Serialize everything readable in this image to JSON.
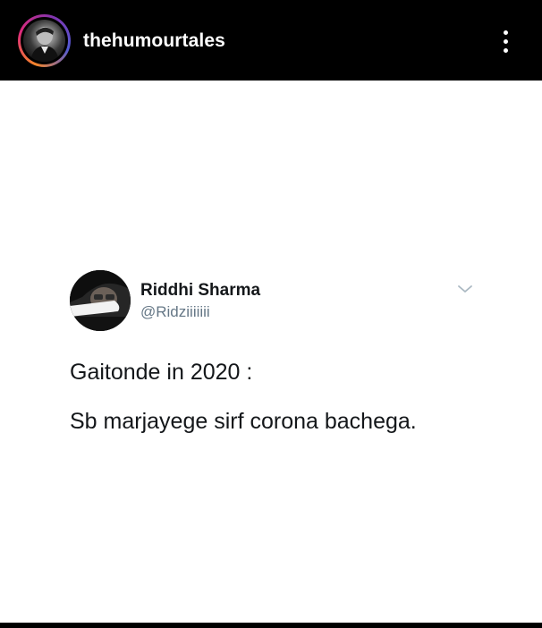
{
  "header": {
    "username": "thehumourtales",
    "avatar_icon": "profile-photo",
    "menu_icon": "more-vertical-icon"
  },
  "tweet": {
    "display_name": "Riddhi Sharma",
    "handle": "@Ridziiiiiii",
    "menu_icon": "chevron-down-icon",
    "lines": [
      "Gaitonde in 2020 :",
      "Sb marjayege sirf corona bachega."
    ]
  },
  "colors": {
    "header_bg": "#000000",
    "post_bg": "#ffffff",
    "text_primary": "#14171a",
    "text_secondary": "#657786",
    "chevron": "#aab8c2"
  }
}
